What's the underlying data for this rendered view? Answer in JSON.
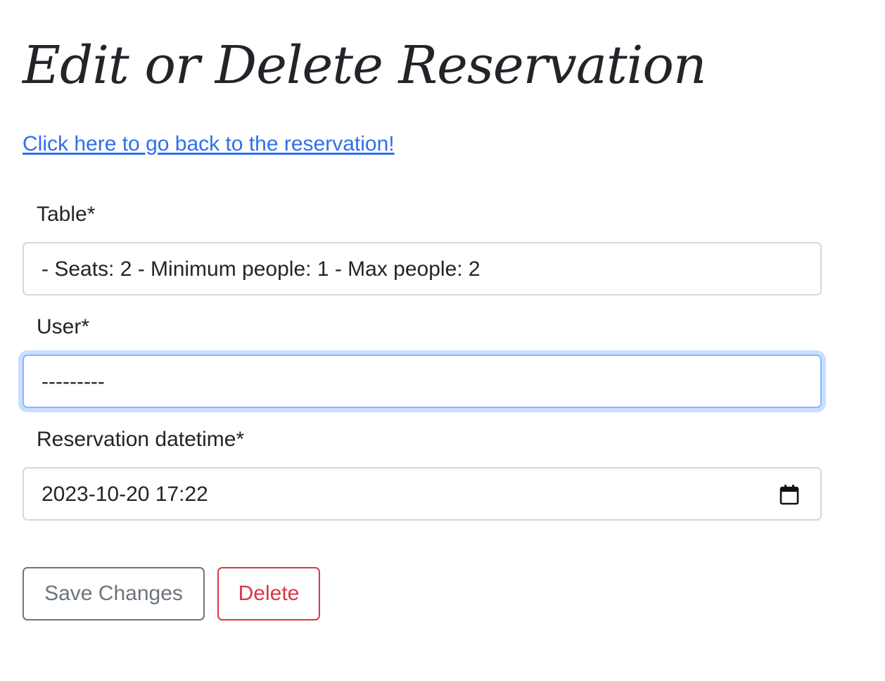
{
  "page": {
    "title": "Edit or Delete Reservation",
    "back_link": "Click here to go back to the reservation!"
  },
  "form": {
    "table": {
      "label": "Table*",
      "value": "- Seats: 2 - Minimum people: 1 - Max people: 2"
    },
    "user": {
      "label": "User*",
      "value": "---------"
    },
    "reservation_datetime": {
      "label": "Reservation datetime*",
      "value": "2023-10-20 17:22",
      "icon": "calendar-icon"
    }
  },
  "actions": {
    "save_label": "Save Changes",
    "delete_label": "Delete"
  },
  "colors": {
    "link": "#2f6fea",
    "save_button": "#6c757d",
    "delete_button": "#dc3545",
    "focus_ring": "#86b7fe"
  }
}
